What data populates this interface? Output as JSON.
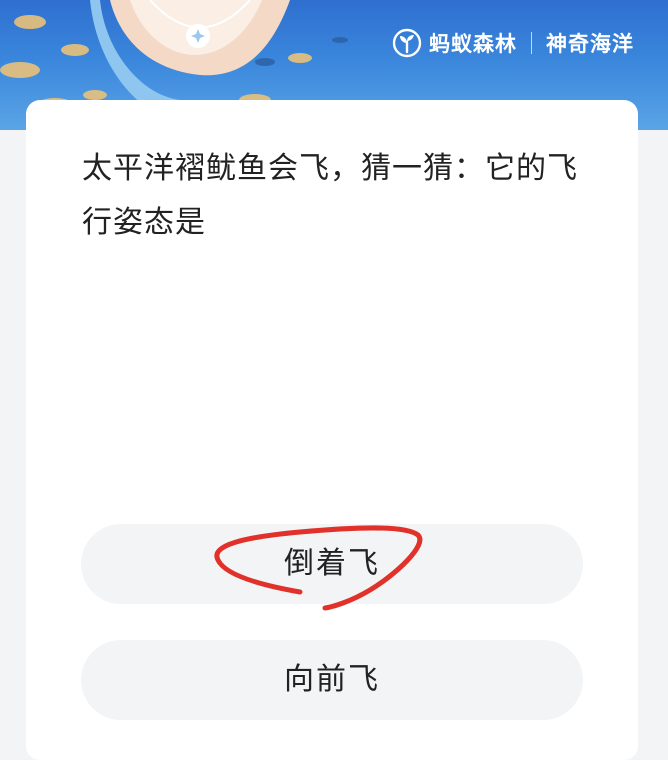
{
  "header": {
    "brand_name": "蚂蚁森林",
    "subtitle": "神奇海洋",
    "logo_icon": "leaf-sprout-icon"
  },
  "quiz": {
    "question": "太平洋褶鱿鱼会飞，猜一猜：它的飞行姿态是",
    "options": [
      {
        "label": "倒着飞"
      },
      {
        "label": "向前飞"
      }
    ]
  },
  "colors": {
    "banner_blue": "#3a86dc",
    "annotation_red": "#e0322a",
    "option_bg": "#f3f4f6"
  }
}
